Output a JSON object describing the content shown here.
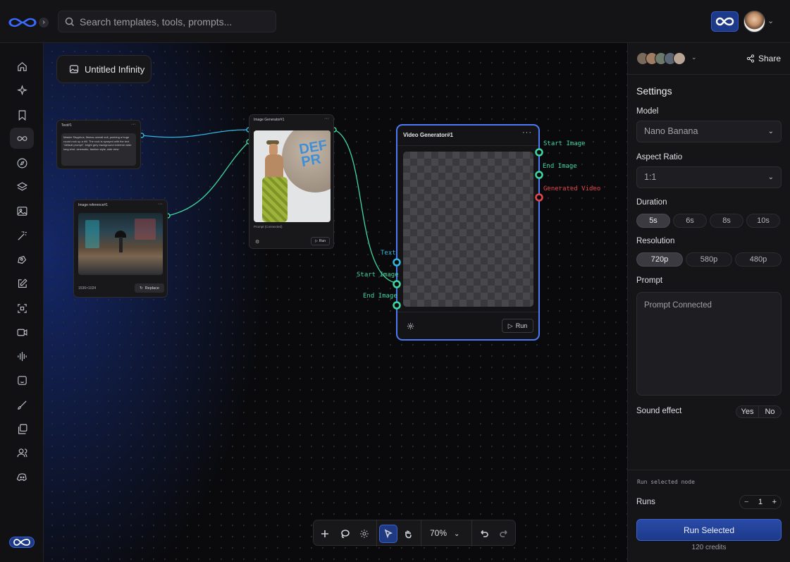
{
  "search": {
    "placeholder": "Search templates, tools, prompts..."
  },
  "colors": {
    "accent": "#4d79f5",
    "brand": "#1d3a8a",
    "wire_cyan": "#2fb7e0",
    "wire_green": "#3fd8a0",
    "port_red": "#e5474d"
  },
  "sidebar": {
    "items": [
      {
        "icon": "home-icon"
      },
      {
        "icon": "sparkles-icon"
      },
      {
        "icon": "bookmark-icon"
      },
      {
        "icon": "infinity-icon",
        "active": true
      },
      {
        "icon": "compass-icon"
      },
      {
        "icon": "layers-icon"
      },
      {
        "icon": "image-icon"
      },
      {
        "icon": "magic-wand-icon"
      },
      {
        "icon": "pen-tool-icon"
      },
      {
        "icon": "edit-icon"
      },
      {
        "icon": "crop-icon"
      },
      {
        "icon": "video-icon"
      },
      {
        "icon": "audio-wave-icon"
      },
      {
        "icon": "face-icon"
      },
      {
        "icon": "brush-icon"
      },
      {
        "icon": "gallery-icon"
      },
      {
        "icon": "users-icon"
      },
      {
        "icon": "discord-icon"
      }
    ]
  },
  "canvas": {
    "title": "Untitled Infinity",
    "text_node": {
      "title": "Text#1",
      "text": "Master Sisyphus, fitness overall suit, pushing a huge round rock up a hill. The rock is sprayed with the text \"default prompt\", bright grey background extreme wide long shot, cinematic, fashion style, side view"
    },
    "image_ref_node": {
      "title": "Image reference#1",
      "size": "1536×1024",
      "replace_label": "Replace"
    },
    "image_gen_node": {
      "title": "Image Generator#1",
      "prompt_note": "Prompt (Connected)",
      "run_label": "Run"
    },
    "video_node": {
      "title": "Video Generator#1",
      "run_label": "Run",
      "inputs": [
        "Text",
        "Start Image",
        "End Image"
      ],
      "outputs": [
        "Start Image",
        "End Image",
        "Generated Video"
      ]
    }
  },
  "toolbar": {
    "zoom": "70%"
  },
  "panel": {
    "share_label": "Share",
    "settings_title": "Settings",
    "model_label": "Model",
    "model_value": "Nano Banana",
    "aspect_label": "Aspect Ratio",
    "aspect_value": "1:1",
    "duration_label": "Duration",
    "durations": [
      "5s",
      "6s",
      "8s",
      "10s"
    ],
    "duration_selected": "5s",
    "resolution_label": "Resolution",
    "resolutions": [
      "720p",
      "580p",
      "480p"
    ],
    "resolution_selected": "720p",
    "prompt_label": "Prompt",
    "prompt_placeholder": "Prompt Connected",
    "sound_label": "Sound effect",
    "sound_yes": "Yes",
    "sound_no": "No",
    "run_note": "Run selected node",
    "runs_label": "Runs",
    "runs_minus": "−",
    "runs_value": "1",
    "runs_plus": "+",
    "run_button": "Run Selected",
    "credits": "120 credits"
  }
}
